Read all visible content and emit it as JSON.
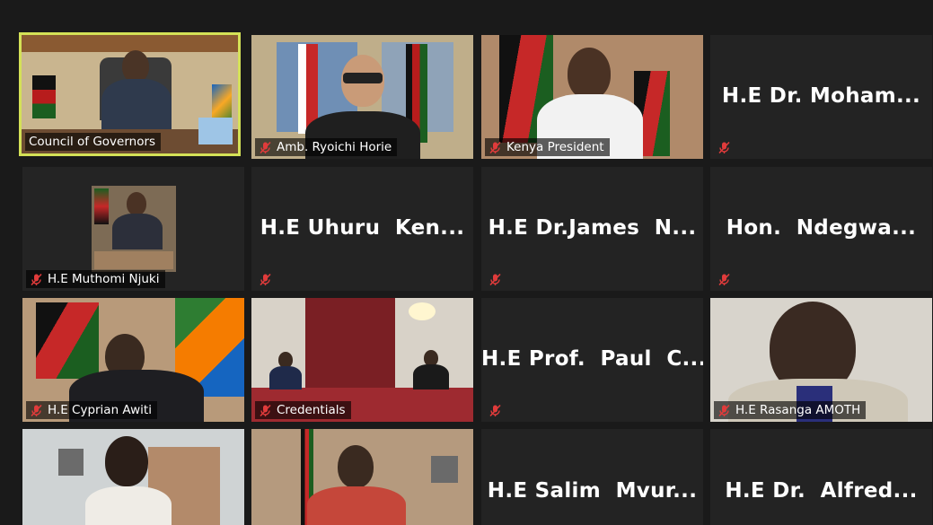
{
  "participants": [
    {
      "name": "Council of Governors",
      "video": true
    },
    {
      "name": "Amb. Ryoichi Horie",
      "video": true
    },
    {
      "name": "Kenya President",
      "video": true
    },
    {
      "name": "H.E Dr. Moham...",
      "video": false
    },
    {
      "name": "H.E Muthomi Njuki",
      "video": true
    },
    {
      "name": "H.E Uhuru  Ken...",
      "video": false
    },
    {
      "name": "H.E Dr.James  N...",
      "video": false
    },
    {
      "name": "Hon.  Ndegwa...",
      "video": false
    },
    {
      "name": "H.E Cyprian Awiti",
      "video": true
    },
    {
      "name": "Credentials",
      "video": true
    },
    {
      "name": "H.E Prof.  Paul  C...",
      "video": false
    },
    {
      "name": "H.E Rasanga AMOTH",
      "video": true
    },
    {
      "name": "",
      "video": true
    },
    {
      "name": "",
      "video": true
    },
    {
      "name": "H.E Salim  Mvur...",
      "video": false
    },
    {
      "name": "H.E Dr.  Alfred...",
      "video": false
    }
  ],
  "colors": {
    "background": "#1a1a1a",
    "tile": "#232323",
    "active_speaker_border": "#d4e157",
    "muted_icon": "#e03b3b"
  },
  "icons": {
    "muted": "mic-muted-icon"
  }
}
